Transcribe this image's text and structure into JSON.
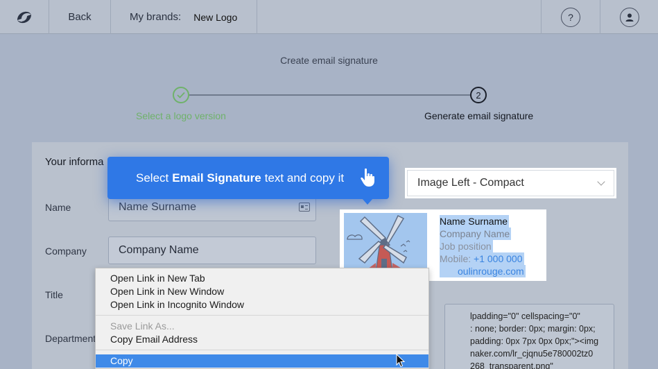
{
  "topbar": {
    "back_label": "Back",
    "brands_label": "My brands:",
    "brand_name": "New Logo",
    "help_label": "?"
  },
  "page": {
    "title": "Create email signature"
  },
  "stepper": {
    "step1_label": "Select a logo version",
    "step2_number": "2",
    "step2_label": "Generate email signature"
  },
  "form": {
    "heading": "Your informa",
    "name_label": "Name",
    "name_placeholder": "Name Surname",
    "company_label": "Company",
    "company_value": "Company Name",
    "title_label": "Title",
    "department_label": "Department"
  },
  "tooltip": {
    "prefix": "Select",
    "bold": "Email Signature",
    "suffix": "text and copy it"
  },
  "template": {
    "selected": "Image Left - Compact"
  },
  "signature": {
    "name": "Name Surname",
    "company": "Company Name",
    "job": "Job position",
    "mobile_label": "Mobile:",
    "mobile_value": "+1 000 000",
    "website_partial": "oulinrouge.com"
  },
  "code": {
    "lines": [
      "lpadding=\"0\" cellspacing=\"0\"",
      ": none; border: 0px; margin: 0px;",
      "padding: 0px 7px 0px 0px;\"><img",
      "naker.com/lr_cjqnu5e780002tz0",
      "268_transparent.png\""
    ]
  },
  "context_menu": {
    "items": [
      "Open Link in New Tab",
      "Open Link in New Window",
      "Open Link in Incognito Window",
      "Save Link As...",
      "Copy Email Address",
      "Copy"
    ]
  },
  "colors": {
    "accent": "#2f78e6",
    "success": "#6fb26a",
    "overlay_bg": "#a8b3c6",
    "menu_highlight": "#3f8ae8"
  }
}
